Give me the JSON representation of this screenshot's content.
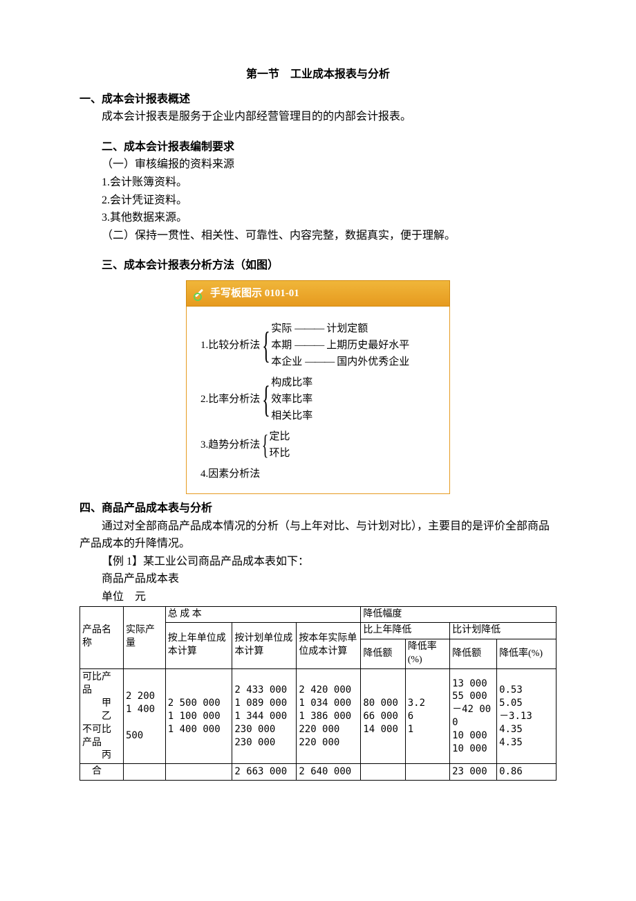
{
  "title": "第一节　工业成本报表与分析",
  "sec1": {
    "heading": "一、成本会计报表概述",
    "p1": "成本会计报表是服务于企业内部经营管理目的的内部会计报表。"
  },
  "sec2": {
    "heading": "二、成本会计报表编制要求",
    "sub1": "（一）审核编报的资料来源",
    "li1": "1.会计账簿资料。",
    "li2": "2.会计凭证资料。",
    "li3": "3.其他数据来源。",
    "sub2": "（二）保持一贯性、相关性、可靠性、内容完整，数据真实，便于理解。"
  },
  "sec3": {
    "heading": "三、成本会计报表分析方法（如图）",
    "diagram_header": "手写板图示  0101-01",
    "m1": "1.比较分析法",
    "m1a_l": "实际",
    "m1a_r": "计划定额",
    "m1b_l": "本期",
    "m1b_r": "上期历史最好水平",
    "m1c_l": "本企业",
    "m1c_r": "国内外优秀企业",
    "m2": "2.比率分析法",
    "m2a": "构成比率",
    "m2b": "效率比率",
    "m2c": "相关比率",
    "m3": "3.趋势分析法",
    "m3a": "定比",
    "m3b": "环比",
    "m4": "4.因素分析法"
  },
  "sec4": {
    "heading": "四、商品产品成本表与分析",
    "p1": "通过对全部商品产品成本情况的分析（与上年对比、与计划对比），主要目的是评价全部商品产品成本的升降情况。",
    "ex": "【例 1】某工业公司商品产品成本表如下：",
    "cap": "商品产品成本表",
    "unit": "单位　元"
  },
  "table": {
    "h_prod": "产品名称",
    "h_qty": "实际产量",
    "h_total": "总 成 本",
    "h_reduce": "降低幅度",
    "h_prev_unit": "按上年单位成本计算",
    "h_plan_unit": "按计划单位成本计算",
    "h_act_unit": "按本年实际单位成本计算",
    "h_vs_prev": "比上年降低",
    "h_vs_plan": "比计划降低",
    "h_amt": "降低额",
    "h_pct": "降低率(%)",
    "names_cell": "可比产品\n　　甲\n　　乙\n不可比产品\n　　丙",
    "qty_cell": "2 200\n1 400\n\n500",
    "prev_cell": "2 500 000\n1 100 000\n1 400 000",
    "plan_cell": "2 433 000\n1 089 000\n1 344 000\n230 000\n230 000",
    "act_cell": "2 420 000\n1 034 000\n1 386 000\n220 000\n220 000",
    "prev_amt_cell": "80 000\n66 000\n14 000",
    "prev_pct_cell": "3.2\n6\n1",
    "plan_amt_cell": "13 000\n55 000\n－42 000\n10 000\n10 000",
    "plan_pct_cell": "0.53\n5.05\n－3.13\n4.35\n4.35",
    "sum_label": "　合",
    "sum_plan": "2 663 000",
    "sum_act": "2 640 000",
    "sum_plan_amt": "23 000",
    "sum_plan_pct": "0.86"
  }
}
